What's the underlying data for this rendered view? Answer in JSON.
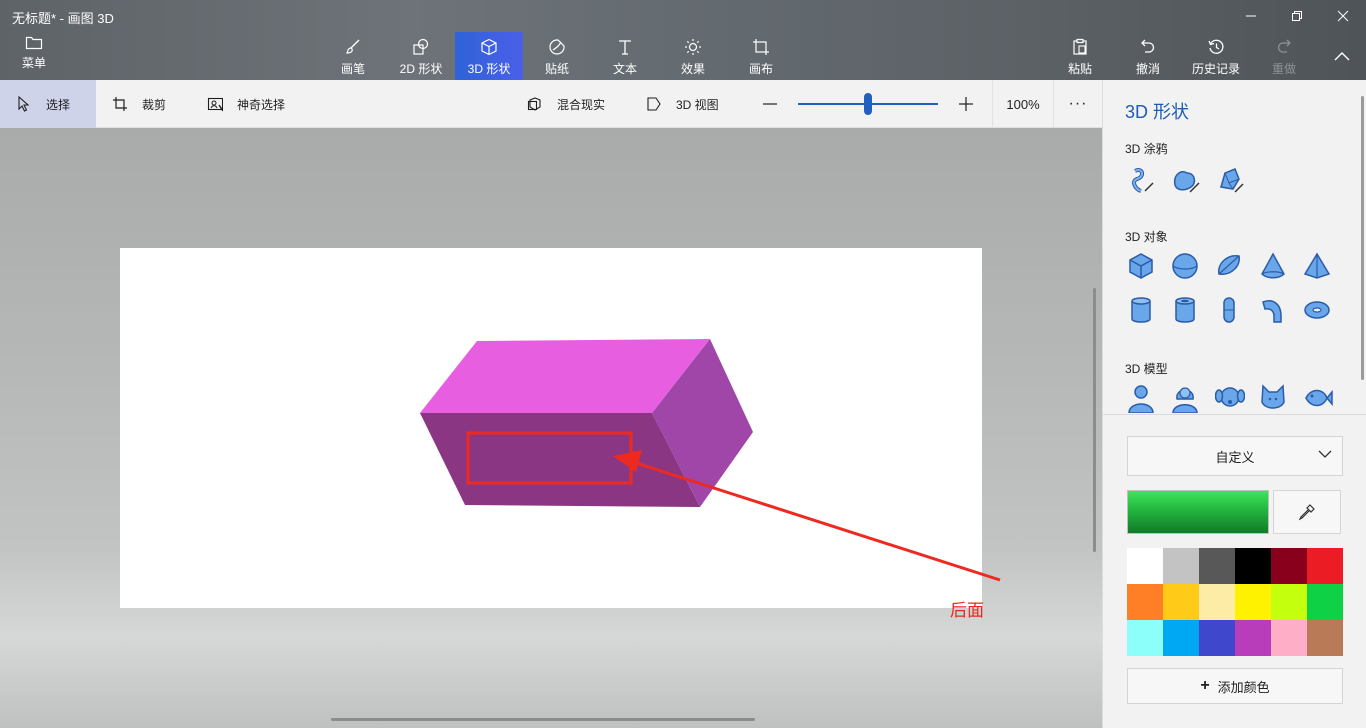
{
  "window": {
    "title": "无标题* - 画图 3D"
  },
  "toolbar": {
    "menu_label": "菜单",
    "tools": [
      {
        "label": "画笔",
        "icon": "brush-icon"
      },
      {
        "label": "2D 形状",
        "icon": "2d-shapes-icon"
      },
      {
        "label": "3D 形状",
        "icon": "3d-cube-icon",
        "active": true
      },
      {
        "label": "贴纸",
        "icon": "sticker-icon"
      },
      {
        "label": "文本",
        "icon": "text-icon"
      },
      {
        "label": "效果",
        "icon": "sun-icon"
      },
      {
        "label": "画布",
        "icon": "canvas-icon"
      }
    ],
    "actions": [
      {
        "label": "粘贴",
        "icon": "paste-icon"
      },
      {
        "label": "撤消",
        "icon": "undo-icon"
      },
      {
        "label": "历史记录",
        "icon": "history-icon"
      },
      {
        "label": "重做",
        "icon": "redo-icon",
        "disabled": true
      }
    ],
    "accent": "#3b63de"
  },
  "subbar": {
    "select_label": "选择",
    "crop_label": "裁剪",
    "magic_select_label": "神奇选择",
    "mixed_reality_label": "混合现实",
    "view3d_label": "3D 视图",
    "zoom_level": "100%",
    "zoom_fraction": 0.5
  },
  "canvas": {
    "annotation_label": "后面",
    "annotation_color": "#e8281e"
  },
  "panel": {
    "title": "3D 形状",
    "doodle_section": "3D 涂鸦",
    "doodle_icons": [
      "sharp-doodle-icon",
      "soft-doodle-icon",
      "tube-doodle-icon"
    ],
    "objects_section": "3D 对象",
    "object_icons": [
      "cube-icon",
      "sphere-icon",
      "hemisphere-icon",
      "cone-icon",
      "pyramid-icon",
      "cylinder-icon",
      "tube-icon",
      "capsule-icon",
      "curved-tube-icon",
      "donut-icon"
    ],
    "models_section": "3D 模型",
    "model_icons": [
      "man-icon",
      "woman-icon",
      "dog-icon",
      "cat-icon",
      "fish-icon"
    ],
    "color_mode": "自定义",
    "current_color": "#25b840",
    "palette": [
      "#ffffff",
      "#c3c3c3",
      "#585858",
      "#000000",
      "#88001b",
      "#ec1c24",
      "#ff7f27",
      "#ffca18",
      "#fdeca6",
      "#fff200",
      "#c4ff0e",
      "#0ed145",
      "#8cfffb",
      "#00a8f3",
      "#3f48cc",
      "#b83dba",
      "#ffaec8",
      "#b97a57"
    ],
    "add_color_label": "添加颜色"
  }
}
